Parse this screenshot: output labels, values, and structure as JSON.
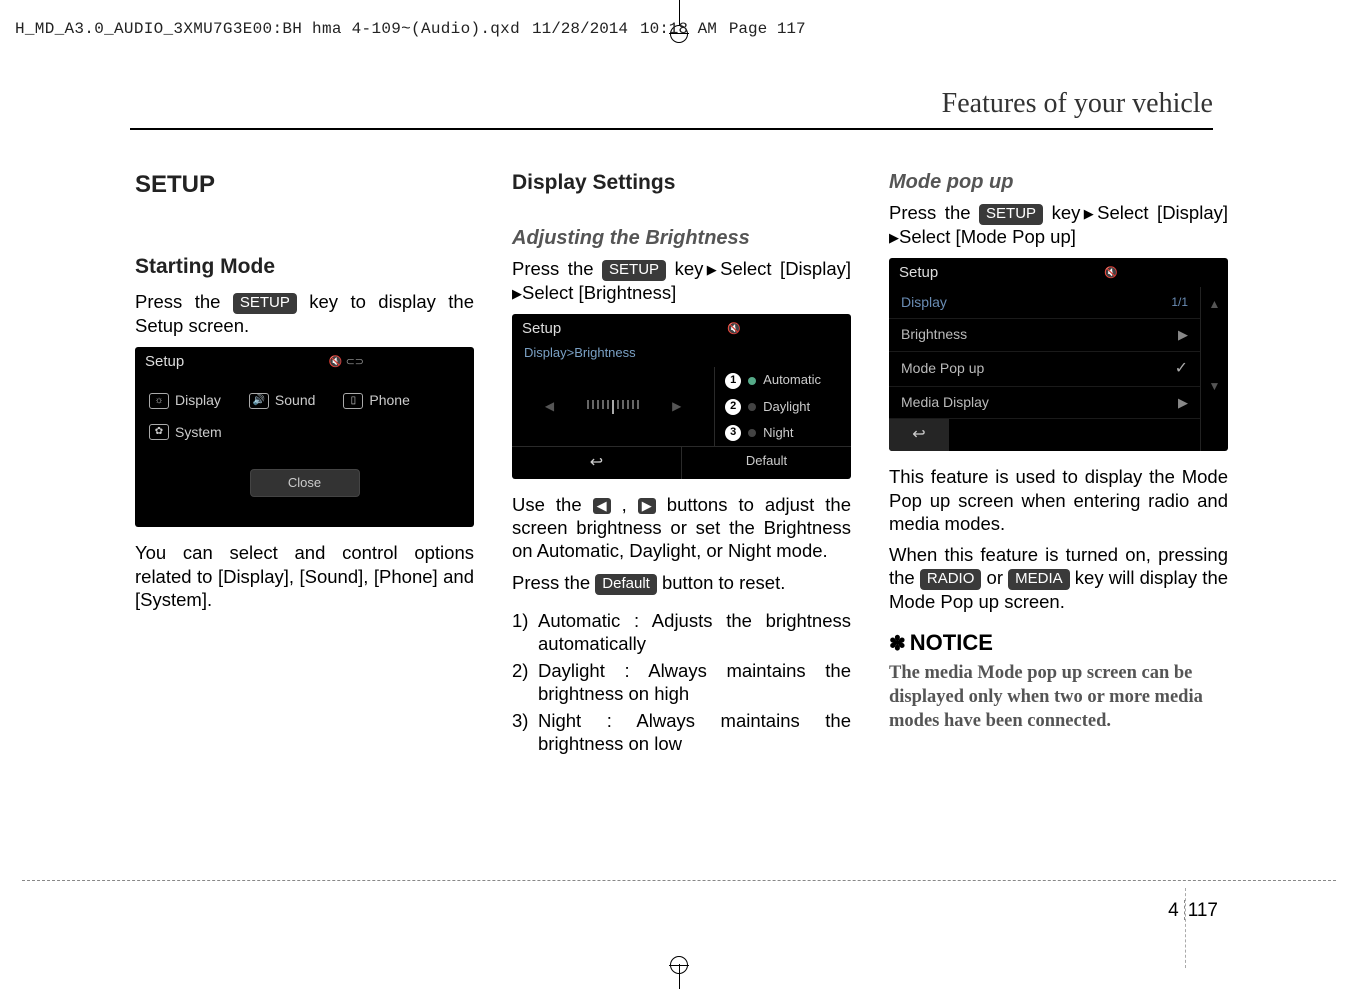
{
  "slug": {
    "file": "H_MD_A3.0_AUDIO_3XMU7G3E00:BH hma 4-109~(Audio).qxd",
    "date": "11/28/2014",
    "time": "10:18 AM",
    "page": "Page 117"
  },
  "header": {
    "title": "Features of your vehicle"
  },
  "col1": {
    "h2": "SETUP",
    "h3": "Starting Mode",
    "p1a": "Press the ",
    "p1_btn": "SETUP",
    "p1b": " key to display the Setup screen.",
    "ss": {
      "title": "Setup",
      "display": "Display",
      "sound": "Sound",
      "phone": "Phone",
      "system": "System",
      "close": "Close"
    },
    "p2": "You can select and control options related to [Display], [Sound], [Phone] and [System]."
  },
  "col2": {
    "h3": "Display Settings",
    "h4a": "Adjusting the Brightness",
    "p1a": "Press the ",
    "p1_btn": "SETUP",
    "p1b": " key",
    "p1c": "Select [Display] ",
    "p1d": "Select [Brightness]",
    "ss": {
      "title": "Setup",
      "sub": "Display>Brightness",
      "opts": [
        "Automatic",
        "Daylight",
        "Night"
      ],
      "back": "↩",
      "default": "Default"
    },
    "p2a": "Use the ",
    "p2b": " buttons to adjust the screen brightness or set the Brightness on Automatic, Daylight, or Night mode.",
    "p3a": "Press the ",
    "p3_btn": "Default",
    "p3b": " button to reset.",
    "list": [
      {
        "n": "1)",
        "t": "Automatic : Adjusts the brightness automatically"
      },
      {
        "n": "2)",
        "t": "Daylight : Always maintains the brightness on high"
      },
      {
        "n": "3)",
        "t": "Night : Always maintains the brightness on low"
      }
    ]
  },
  "col3": {
    "h4": "Mode pop up",
    "p1a": "Press the ",
    "p1_btn": "SETUP",
    "p1b": " key",
    "p1c": "Select [Display] ",
    "p1d": "Select [Mode Pop up]",
    "ss": {
      "title": "Setup",
      "rows": [
        {
          "label": "Display",
          "page": "1/1"
        },
        {
          "label": "Brightness",
          "icon": "▶"
        },
        {
          "label": "Mode Pop up",
          "icon": "✓"
        },
        {
          "label": "Media Display",
          "icon": "▶"
        }
      ],
      "back": "↩"
    },
    "p2": "This feature is used to display the Mode Pop up screen when entering radio and media modes.",
    "p3a": "When this feature is turned on, pressing the ",
    "p3_btn1": "RADIO",
    "p3b": " or ",
    "p3_btn2": "MEDIA",
    "p3c": " key will display the Mode Pop up screen.",
    "notice_h": "NOTICE",
    "notice_b": "The media Mode pop up screen can be displayed only when two or more media modes have been connected."
  },
  "footer": {
    "section": "4",
    "page": "117"
  }
}
